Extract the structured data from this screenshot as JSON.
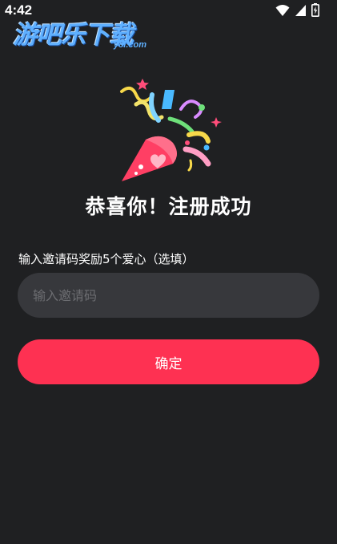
{
  "status_bar": {
    "time": "4:42",
    "icons": [
      "wifi-icon",
      "signal-icon",
      "battery-icon"
    ]
  },
  "watermark": {
    "main": "游吧乐下载",
    "sub": "y8l.com"
  },
  "celebration": {
    "icon": "party-popper-icon"
  },
  "title": "恭喜你！注册成功",
  "invite": {
    "label": "输入邀请码奖励5个爱心（选填）",
    "placeholder": "输入邀请码",
    "value": ""
  },
  "confirm_button": {
    "label": "确定"
  },
  "colors": {
    "background": "#1f2022",
    "input_background": "#37383c",
    "accent": "#fe3152",
    "placeholder": "#6c6d71"
  }
}
